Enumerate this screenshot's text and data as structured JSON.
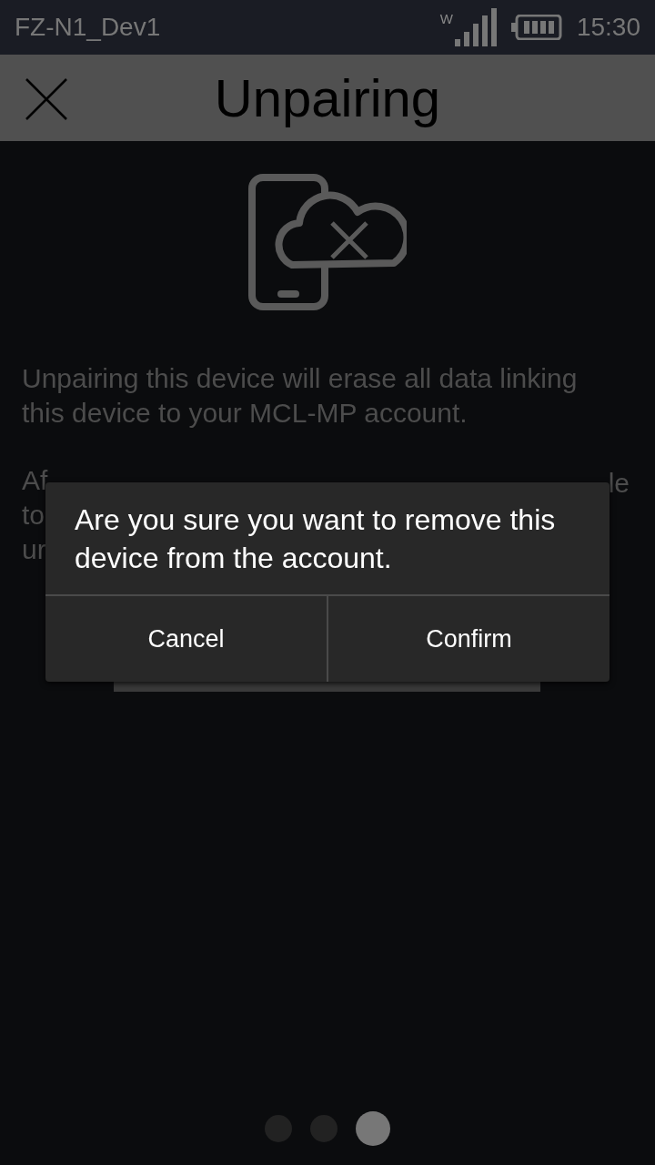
{
  "status_bar": {
    "device_name": "FZ-N1_Dev1",
    "network_label": "W",
    "time": "15:30"
  },
  "app_bar": {
    "title": "Unpairing"
  },
  "body": {
    "paragraph_1": [
      "Unpairing this device will erase all data linking",
      "this device to your MCL-MP account."
    ],
    "paragraph_2": [
      "Af",
      "to",
      "ur"
    ],
    "paragraph_2_right": "le"
  },
  "dialog": {
    "message": "Are you sure you want to remove this device from the account.",
    "buttons": [
      "Cancel",
      "Confirm"
    ]
  },
  "page_indicator": [
    {
      "selected": false
    },
    {
      "selected": false
    },
    {
      "selected": true
    }
  ]
}
